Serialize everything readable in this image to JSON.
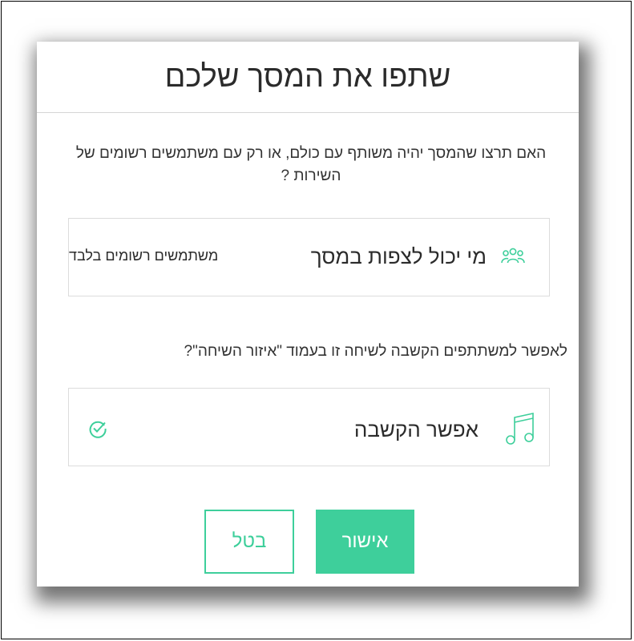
{
  "dialog": {
    "title": "שתפו את המסך שלכם",
    "question": "האם תרצו שהמסך יהיה משותף עם כולם, או רק עם משתמשים רשומים של השירות ?",
    "viewers": {
      "label": "מי יכול לצפות במסך",
      "value": "משתמשים רשומים בלבד",
      "icon": "people-icon"
    },
    "listen_question": "לאפשר למשתתפים הקשבה לשיחה זו בעמוד \"איזור השיחה\"?",
    "listen": {
      "label": "אפשר הקשבה",
      "icon": "music-note-icon",
      "status_icon": "check-circle-icon",
      "enabled": true
    },
    "buttons": {
      "ok": "אישור",
      "cancel": "בטל"
    }
  },
  "colors": {
    "accent": "#3ecf9b",
    "text": "#2b2b2b",
    "border": "#dcdcdc"
  }
}
